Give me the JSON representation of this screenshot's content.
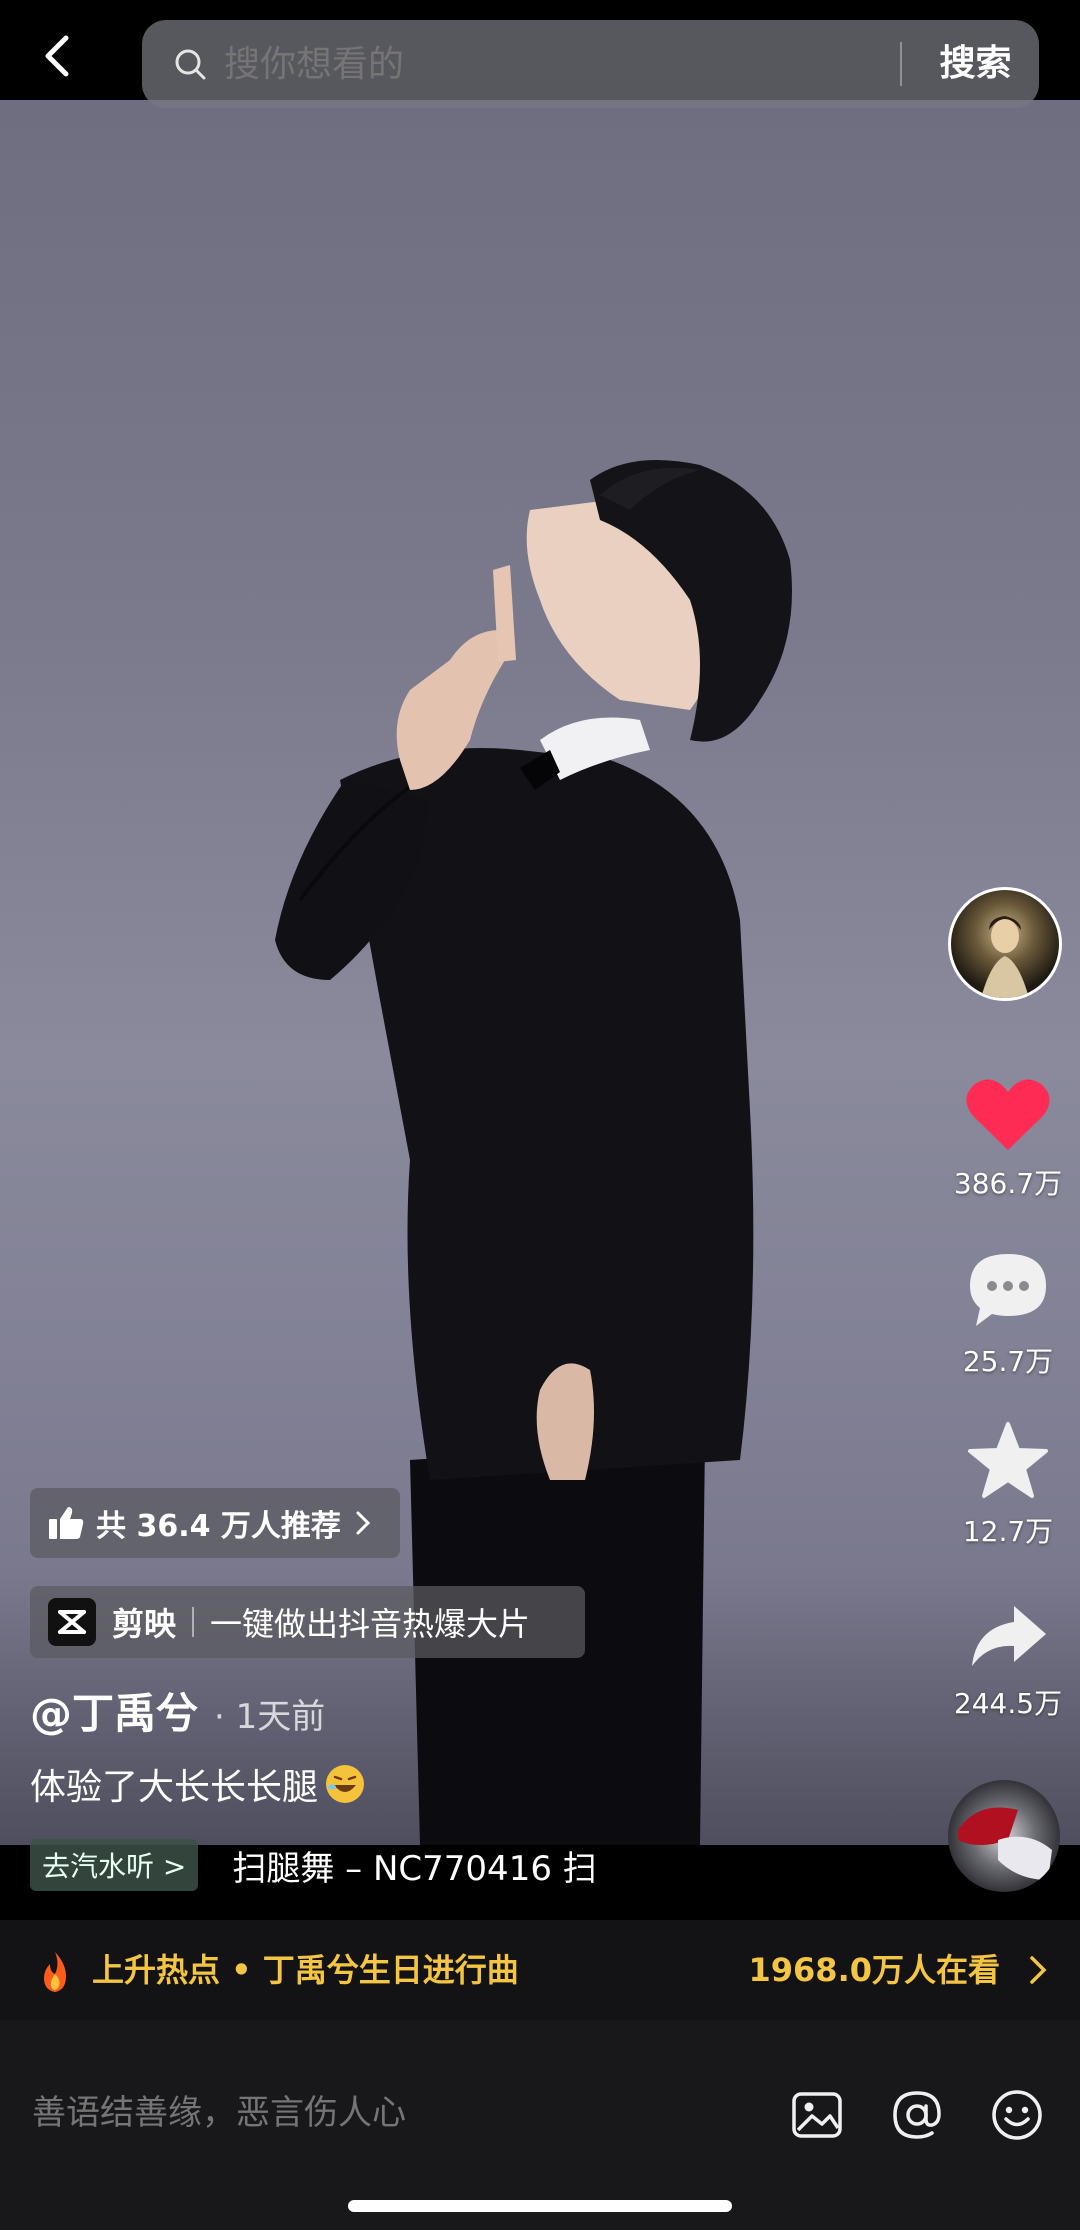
{
  "search": {
    "placeholder": "搜你想看的",
    "button_label": "搜索"
  },
  "rail": {
    "likes": "386.7万",
    "comments": "25.7万",
    "favorites": "12.7万",
    "shares": "244.5万"
  },
  "recommend": {
    "label": "共 36.4 万人推荐"
  },
  "capcut": {
    "name": "剪映",
    "slogan": "一键做出抖音热爆大片"
  },
  "post": {
    "author": "@丁禹兮",
    "time": "· 1天前",
    "caption": "体验了大长长长腿"
  },
  "music": {
    "tag": "去汽水听 >",
    "title": "扫腿舞 – NC770416   扫"
  },
  "hot": {
    "label": "上升热点 • 丁禹兮生日进行曲",
    "viewers": "1968.0万人在看"
  },
  "comment": {
    "placeholder": "善语结善缘，恶言伤人心"
  },
  "colors": {
    "like_red": "#fe2c55",
    "hot_yellow": "#f4c542",
    "background": "#000000"
  }
}
